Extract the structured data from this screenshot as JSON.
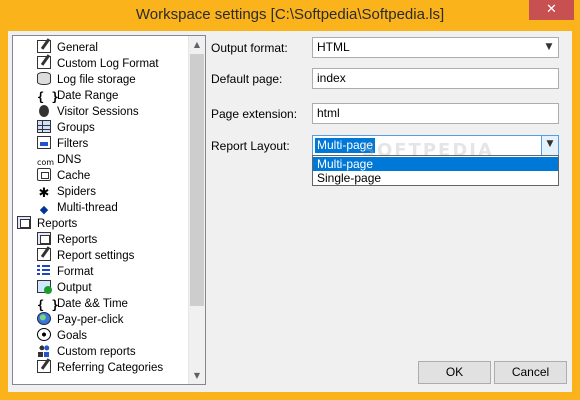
{
  "window": {
    "title": "Workspace settings [C:\\Softpedia\\Softpedia.ls]",
    "close_glyph": "✕",
    "accent_color": "#fbb31c"
  },
  "tree": {
    "items": [
      {
        "label": "General",
        "icon": "settings-doc-icon"
      },
      {
        "label": "Custom Log Format",
        "icon": "edit-doc-icon"
      },
      {
        "label": "Log file storage",
        "icon": "database-icon"
      },
      {
        "label": "Date Range",
        "icon": "braces-icon",
        "glyph": "{ }"
      },
      {
        "label": "Visitor Sessions",
        "icon": "user-icon"
      },
      {
        "label": "Groups",
        "icon": "grid-icon"
      },
      {
        "label": "Filters",
        "icon": "filter-icon"
      },
      {
        "label": "DNS",
        "icon": "com-icon",
        "glyph": "com"
      },
      {
        "label": "Cache",
        "icon": "cache-icon"
      },
      {
        "label": "Spiders",
        "icon": "spider-icon",
        "glyph": "✱"
      },
      {
        "label": "Multi-thread",
        "icon": "multithread-icon",
        "glyph": "◆"
      },
      {
        "label": "Reports",
        "icon": "reports-folder-icon"
      },
      {
        "label": "Reports",
        "icon": "reports-doc-icon"
      },
      {
        "label": "Report settings",
        "icon": "edit-doc-icon"
      },
      {
        "label": "Format",
        "icon": "list-icon"
      },
      {
        "label": "Output",
        "icon": "output-icon"
      },
      {
        "label": "Date && Time",
        "icon": "braces-icon",
        "glyph": "{ }"
      },
      {
        "label": "Pay-per-click",
        "icon": "globe-icon"
      },
      {
        "label": "Goals",
        "icon": "soccer-ball-icon"
      },
      {
        "label": "Custom reports",
        "icon": "people-icon"
      },
      {
        "label": "Referring Categories",
        "icon": "edit-doc-icon"
      }
    ],
    "scroll_up": "▲",
    "scroll_down": "▼"
  },
  "form": {
    "output_format": {
      "label": "Output format:",
      "value": "HTML"
    },
    "default_page": {
      "label": "Default page:",
      "value": "index"
    },
    "page_extension": {
      "label": "Page extension:",
      "value": "html"
    },
    "report_layout": {
      "label": "Report Layout:",
      "value": "Multi-page",
      "options": [
        "Multi-page",
        "Single-page"
      ]
    },
    "dropdown_arrow": "▼"
  },
  "watermark": "SOFTPEDIA",
  "buttons": {
    "ok": "OK",
    "cancel": "Cancel"
  }
}
